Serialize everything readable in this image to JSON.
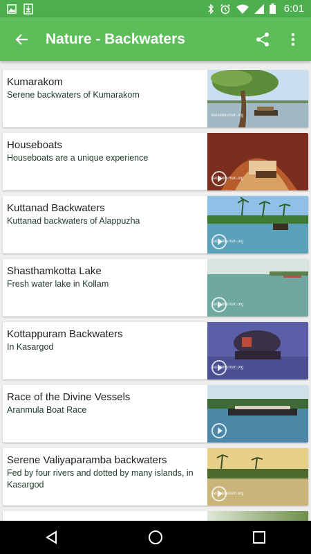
{
  "status_bar": {
    "time": "6:01",
    "left_icons": [
      "image-icon",
      "download-icon"
    ],
    "right_icons": [
      "bluetooth-icon",
      "alarm-icon",
      "wifi-icon",
      "signal-icon",
      "battery-icon"
    ]
  },
  "app_bar": {
    "title": "Nature - Backwaters",
    "back_icon": "arrow-back-icon",
    "actions": [
      "share-icon",
      "more-vert-icon"
    ]
  },
  "colors": {
    "status_bar": "#4cae4c",
    "app_bar": "#5cbd59",
    "background": "#eeeeee",
    "nav_bar": "#000000"
  },
  "items": [
    {
      "title": "Kumarakom",
      "subtitle": "Serene backwaters of Kumarakom",
      "watermark": "keralatourism.org"
    },
    {
      "title": "Houseboats",
      "subtitle": "Houseboats are a unique experience",
      "watermark": "keralatourism.org"
    },
    {
      "title": "Kuttanad Backwaters",
      "subtitle": "Kuttanad backwaters of Alappuzha",
      "watermark": "keralatourism.org"
    },
    {
      "title": "Shasthamkotta Lake",
      "subtitle": "Fresh water lake in Kollam",
      "watermark": "keralatourism.org"
    },
    {
      "title": "Kottappuram Backwaters",
      "subtitle": "In Kasargod",
      "watermark": "keralatourism.org"
    },
    {
      "title": "Race of the Divine Vessels",
      "subtitle": "Aranmula Boat Race",
      "watermark": ""
    },
    {
      "title": "Serene Valiyaparamba backwaters",
      "subtitle": "Fed by four rivers and dotted by many islands, in Kasargod",
      "watermark": "keralatourism.org"
    }
  ],
  "nav_bar": {
    "buttons": [
      "back-triangle-icon",
      "home-circle-icon",
      "recents-square-icon"
    ]
  }
}
